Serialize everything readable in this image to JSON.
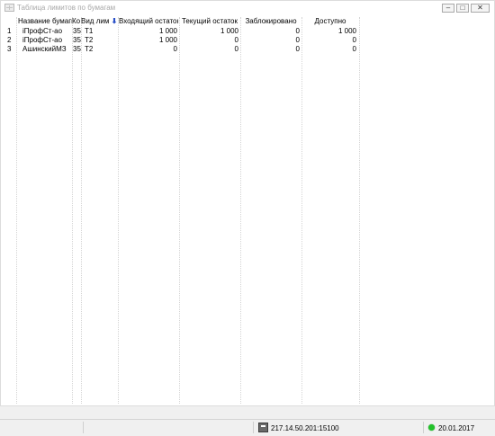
{
  "window": {
    "title": "Таблица лимитов по бумагам",
    "buttons": {
      "minimize": "–",
      "maximize": "□",
      "close": "✕"
    }
  },
  "table": {
    "columns": [
      "Название бумаги",
      "Ко",
      "Вид лим",
      "Входящий остаток",
      "Текущий остаток",
      "Заблокировано",
      "Доступно"
    ],
    "sort_indicator": "⬇",
    "rows": [
      {
        "n": "1",
        "name": "iПрофСт-ао",
        "code": "35.",
        "type": "T1",
        "incoming": "1 000",
        "current": "1 000",
        "blocked": "0",
        "available": "1 000"
      },
      {
        "n": "2",
        "name": "iПрофСт-ао",
        "code": "35.",
        "type": "T2",
        "incoming": "1 000",
        "current": "0",
        "blocked": "0",
        "available": "0"
      },
      {
        "n": "3",
        "name": "АшинскийМЗ",
        "code": "35.",
        "type": "T2",
        "incoming": "0",
        "current": "0",
        "blocked": "0",
        "available": "0"
      }
    ]
  },
  "statusbar": {
    "server": "217.14.50.201:15100",
    "date": "20.01.2017",
    "connection_color": "#22c22a"
  }
}
